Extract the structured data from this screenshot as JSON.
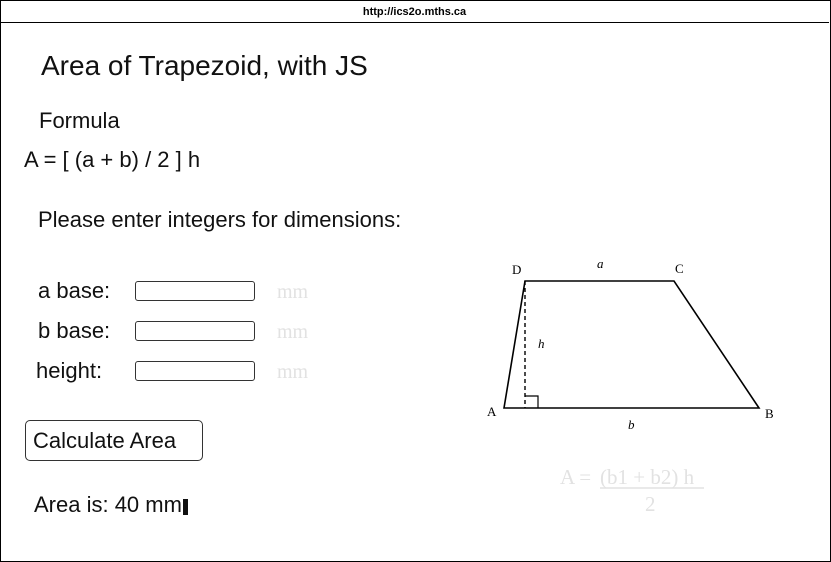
{
  "browser": {
    "url": "http://ics2o.mths.ca"
  },
  "page": {
    "title": "Area of Trapezoid, with JS",
    "formula_heading": "Formula",
    "formula_text": "A = [ (a + b) / 2 ] h",
    "instructions": "Please enter integers for dimensions:"
  },
  "form": {
    "a_base": {
      "label": "a base:",
      "value": "",
      "unit": "mm"
    },
    "b_base": {
      "label": "b base:",
      "value": "",
      "unit": "mm"
    },
    "height": {
      "label": "height:",
      "value": "",
      "unit": "mm"
    },
    "button_label": "Calculate Area"
  },
  "result": {
    "text": "Area is: 40 mm"
  },
  "diagram": {
    "vertex_a": "A",
    "vertex_b": "B",
    "vertex_c": "C",
    "vertex_d": "D",
    "side_a": "a",
    "side_b": "b",
    "height_label": "h",
    "formula_lhs": "A = ",
    "formula_numerator": "(b1 + b2) h",
    "formula_denominator": "2"
  },
  "colors": {
    "watermark": "#e2e2e2",
    "text": "#111111",
    "border": "#000000"
  }
}
